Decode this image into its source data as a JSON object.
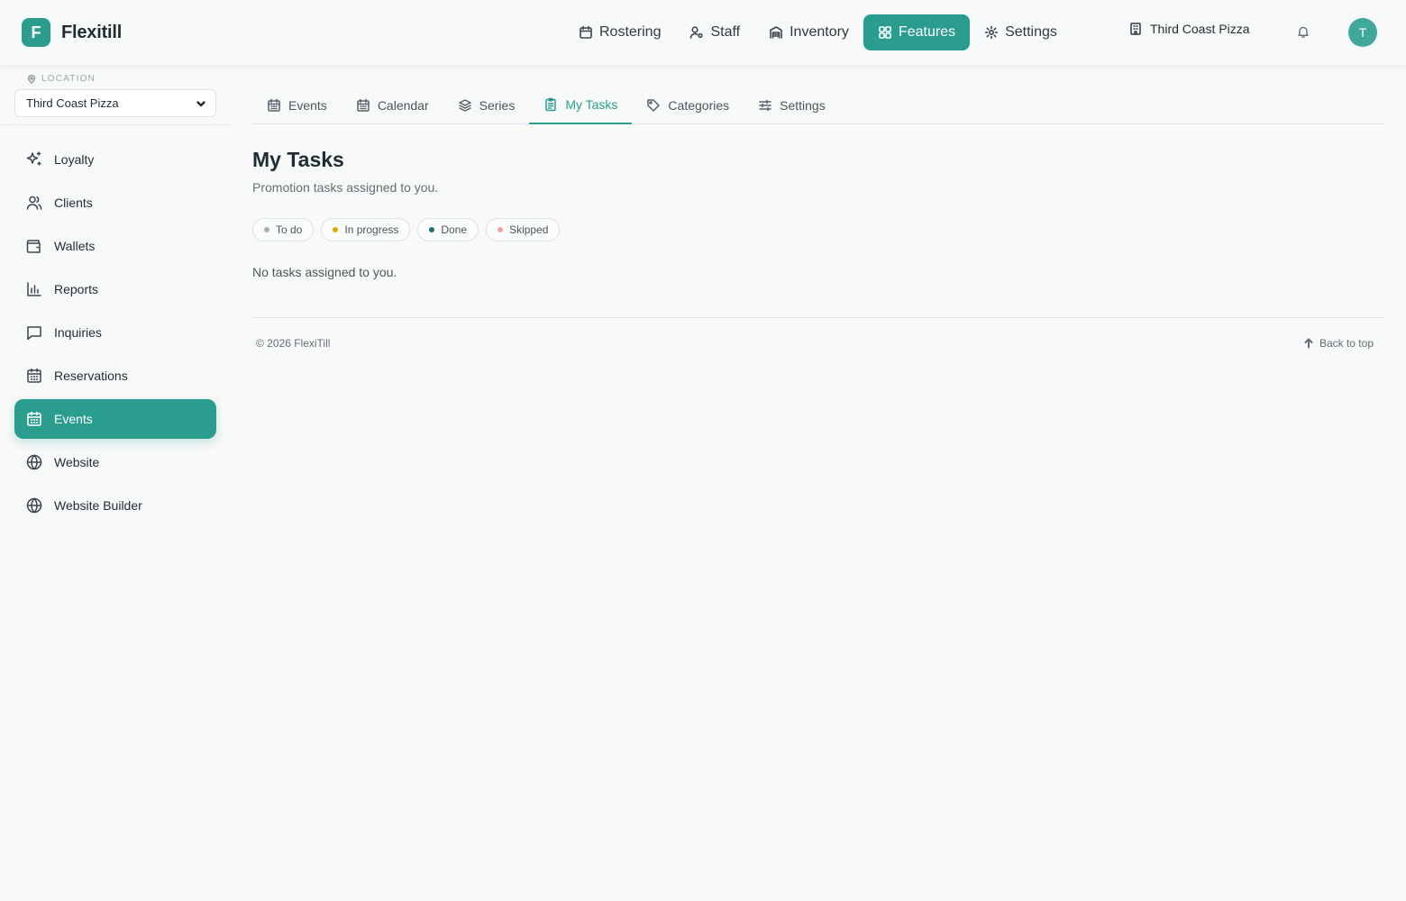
{
  "app": {
    "logo_letter": "F",
    "name": "Flexitill"
  },
  "topnav": {
    "items": [
      {
        "label": "Rostering",
        "icon": "calendar-icon"
      },
      {
        "label": "Staff",
        "icon": "user-cog-icon"
      },
      {
        "label": "Inventory",
        "icon": "warehouse-icon"
      },
      {
        "label": "Features",
        "icon": "grid-icon",
        "active": true
      },
      {
        "label": "Settings",
        "icon": "gear-icon"
      }
    ],
    "location": "Third Coast Pizza",
    "avatar_letter": "T"
  },
  "sidebar": {
    "location_label": "LOCATION",
    "location_value": "Third Coast Pizza",
    "items": [
      {
        "label": "Loyalty",
        "icon": "sparkles-icon"
      },
      {
        "label": "Clients",
        "icon": "users-icon"
      },
      {
        "label": "Wallets",
        "icon": "wallet-icon"
      },
      {
        "label": "Reports",
        "icon": "bar-chart-icon"
      },
      {
        "label": "Inquiries",
        "icon": "message-square-icon"
      },
      {
        "label": "Reservations",
        "icon": "calendar-grid-icon"
      },
      {
        "label": "Events",
        "icon": "calendar-grid-icon",
        "active": true
      },
      {
        "label": "Website",
        "icon": "globe-icon"
      },
      {
        "label": "Website Builder",
        "icon": "globe-icon"
      }
    ]
  },
  "subtabs": [
    {
      "label": "Events",
      "icon": "calendar-grid-icon"
    },
    {
      "label": "Calendar",
      "icon": "calendar-grid-icon"
    },
    {
      "label": "Series",
      "icon": "layers-icon"
    },
    {
      "label": "My Tasks",
      "icon": "clipboard-icon",
      "active": true
    },
    {
      "label": "Categories",
      "icon": "tag-icon"
    },
    {
      "label": "Settings",
      "icon": "sliders-icon"
    }
  ],
  "page": {
    "title": "My Tasks",
    "subtitle": "Promotion tasks assigned to you.",
    "filters": [
      {
        "label": "To do",
        "color": "#a8b0b3"
      },
      {
        "label": "In progress",
        "color": "#e0a800"
      },
      {
        "label": "Done",
        "color": "#1f6f73"
      },
      {
        "label": "Skipped",
        "color": "#f0a39a"
      }
    ],
    "empty_text": "No tasks assigned to you."
  },
  "footer": {
    "copyright": "© 2026 FlexiTill",
    "back_to_top": "Back to top"
  },
  "colors": {
    "accent": "#2a9d8f"
  }
}
